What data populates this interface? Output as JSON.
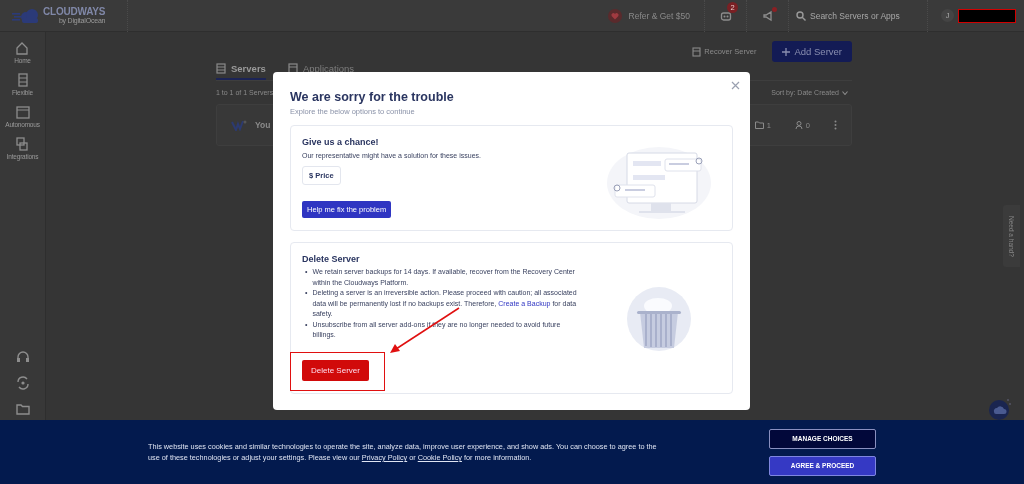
{
  "topbar": {
    "logo": "CLOUDWAYS",
    "logo_sub": "by DigitalOcean",
    "refer": "Refer & Get $50",
    "notification_count": "2",
    "search": {
      "placeholder": "Search Servers or Apps"
    },
    "avatar": "J"
  },
  "sidebar": {
    "items": [
      {
        "label": "Home"
      },
      {
        "label": "Flexible"
      },
      {
        "label": "Autonomous"
      },
      {
        "label": "Integrations"
      }
    ]
  },
  "toolbar": {
    "recover": "Recover Server",
    "add": "Add Server"
  },
  "tabs": [
    {
      "label": "Servers",
      "selected": true
    },
    {
      "label": "Applications",
      "selected": false
    }
  ],
  "list_count": "1 to 1 of 1 Servers",
  "sort": "Sort by: Date Created",
  "server_row": {
    "name": "You",
    "apps": "1",
    "members": "0"
  },
  "help_tab": "Need a hand?",
  "modal": {
    "title": "We are sorry for the trouble",
    "subtitle": "Explore the below options to continue",
    "chance_card": {
      "title": "Give us a chance!",
      "text": "Our representative might have a solution for these issues.",
      "chip": "$ Price",
      "button": "Help me fix the problem"
    },
    "delete_card": {
      "title": "Delete Server",
      "bullets": [
        {
          "marker": "•",
          "parts": [
            {
              "kind": "text",
              "text": "We retain server backups for 14 days. If available, recover from the Recovery Center within the Cloudways Platform."
            }
          ]
        },
        {
          "marker": "•",
          "parts": [
            {
              "kind": "text",
              "text": "Deleting a server is an irreversible action. Please proceed with caution; all associated data will be permanently lost if no backups exist. Therefore, "
            },
            {
              "kind": "link",
              "text": "Create a Backup"
            },
            {
              "kind": "text",
              "text": " for data safety."
            }
          ]
        },
        {
          "marker": "•",
          "parts": [
            {
              "kind": "text",
              "text": "Unsubscribe from all server add-ons if they are no longer needed to avoid future billings."
            }
          ]
        }
      ],
      "button": "Delete Server"
    }
  },
  "cookie_banner": {
    "text": [
      {
        "kind": "text",
        "text": "This website uses cookies and similar technologies to operate the site, analyze data, improve user experience, and show ads. You can choose to agree to the use of these technologies or adjust your settings. Please view our "
      },
      {
        "kind": "link",
        "text": "Privacy Policy"
      },
      {
        "kind": "text",
        "text": " or "
      },
      {
        "kind": "link",
        "text": "Cookie Policy"
      },
      {
        "kind": "text",
        "text": " for more information."
      }
    ],
    "buttons": [
      {
        "label": "MANAGE CHOICES",
        "kind": "secondary"
      },
      {
        "label": "AGREE & PROCEED",
        "kind": "primary"
      }
    ]
  }
}
